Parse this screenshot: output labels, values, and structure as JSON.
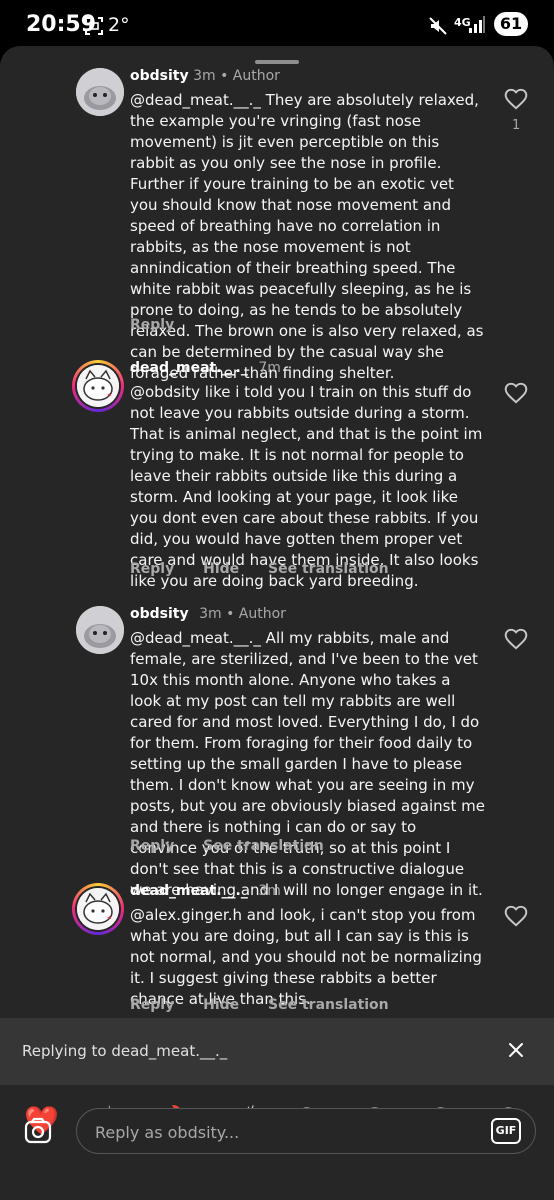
{
  "status_bar": {
    "time": "20:59",
    "temperature": "2°",
    "network": "4G",
    "battery": "61"
  },
  "comments": [
    {
      "username": "obdsity",
      "time": "3m",
      "tag": "Author",
      "text": "@dead_meat.__._ They are absolutely relaxed, the example you're vringing (fast nose movement) is jit even perceptible on this rabbit as you only see the nose in profile. Further if youre training to be an exotic vet you should know that nose movement and speed of breathing have no correlation in rabbits, as the nose movement is not annindication of their breathing speed. The white rabbit was peacefully sleeping, as he is prone to doing, as he tends to be absolutely relaxed. The brown one is also very relaxed, as can be determined by the casual way she foraged rather than finding shelter.",
      "reply": "Reply",
      "likes": "1"
    },
    {
      "username": "dead_meat.__._",
      "time": "7m",
      "text": "@obdsity like i told you I train on this stuff do not leave you rabbits outside during a storm. That is animal neglect, and that is the point im trying to make. It is not normal for people to leave their rabbits outside like this during a storm. And looking at your page, it look like you dont even care about these rabbits. If you did, you would have gotten them proper vet care and would have them inside. It also looks like you are doing back yard breeding.",
      "reply": "Reply",
      "hide": "Hide",
      "translate": "See translation"
    },
    {
      "username": "obdsity",
      "time": "3m",
      "tag": "Author",
      "text": "@dead_meat.__._ All my rabbits, male and female, are sterilized, and I've been to the vet 10x this month alone. Anyone who takes a look at my post can tell my rabbits are well cared for and most loved. Everything I do, I do for them. From foraging for their food daily to setting up the small garden I have to please them. I don't know what you are seeing in my posts, but you are obviously biased against me and there is nothing i can do or say to convince you of the truth, so at this point I don't see that this is a constructive dialogue we are having and I will no longer engage in it.",
      "reply": "Reply",
      "translate": "See translation"
    },
    {
      "username": "dead_meat.__._",
      "time": "3m",
      "text": "@alex.ginger.h and look, i can't stop you from what you are doing, but all I can say is this is not normal, and you should not be normalizing it. I suggest giving these rabbits a better chance at live than this.",
      "reply": "Reply",
      "hide": "Hide",
      "translate": "See translation"
    }
  ],
  "replying_to": "Replying to dead_meat.__._",
  "emojis": [
    "❤️",
    "🙌",
    "🔥",
    "👏",
    "😢",
    "😍",
    "😮",
    "😂"
  ],
  "compose": {
    "placeholder": "Reply as obdsity...",
    "gif_label": "GIF"
  },
  "colors": {
    "sheet_bg": "#262626",
    "reply_bar_bg": "#363636",
    "secondary_text": "#a8a8a8"
  }
}
